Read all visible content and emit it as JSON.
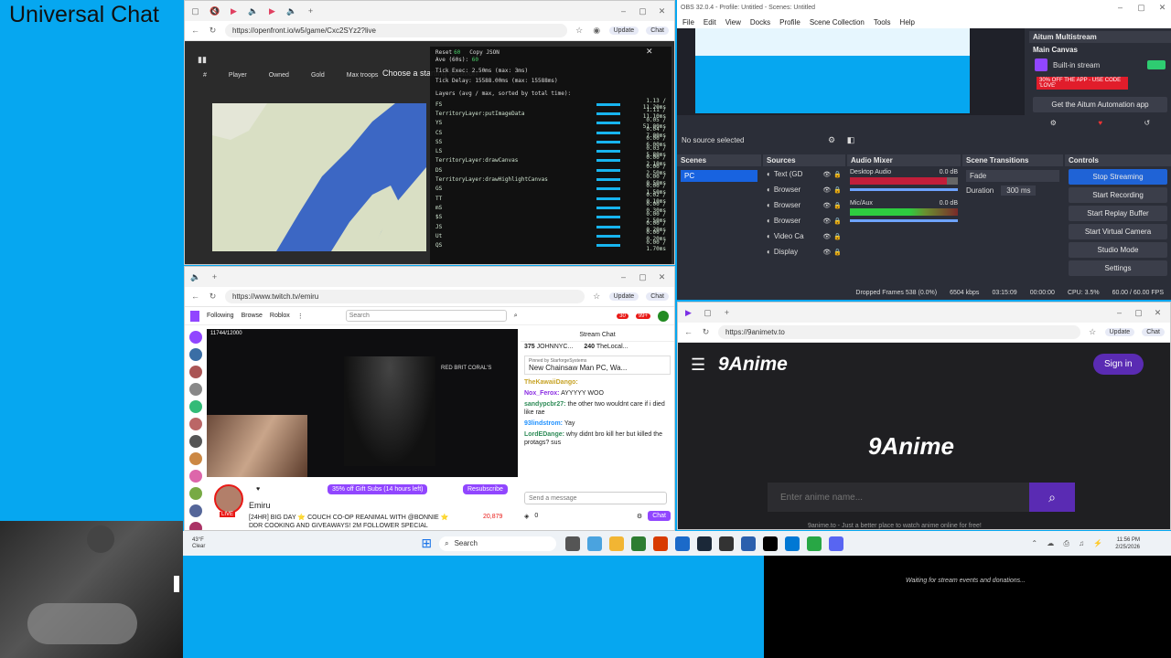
{
  "overlay_title": "Universal Chat",
  "stream_status": "Waiting for stream events and donations...",
  "openfront": {
    "url": "https://openfront.io/w5/game/Cxc2SYz2?live",
    "update_label": "Update",
    "chat_label": "Chat",
    "columns": [
      "#",
      "Player",
      "Owned",
      "Gold",
      "Max troops"
    ],
    "overlay_text": "Choose a starting location",
    "reset_label": "Reset",
    "reset_value": "60",
    "copy_label": "Copy JSON",
    "ave_label": "Ave (60s):",
    "ave_value": "60",
    "tick_exec": "Tick Exec: 2.50ms (max: 3ms)",
    "tick_delay": "Tick Delay: 15588.00ms (max: 15588ms)",
    "layers_header": "Layers (avg / max, sorted by total time):",
    "layers": [
      {
        "name": "FS",
        "value": "1.13 / 11.20ms"
      },
      {
        "name": "TerritoryLayer:putImageData",
        "value": "1.11 / 11.10ms"
      },
      {
        "name": "YS",
        "value": "0.05 / 51.00ms"
      },
      {
        "name": "CS",
        "value": "0.04 / 7.00ms"
      },
      {
        "name": "SS",
        "value": "0.00 / 6.00ms"
      },
      {
        "name": "LS",
        "value": "0.03 / 5.80ms"
      },
      {
        "name": "TerritoryLayer:drawCanvas",
        "value": "0.00 / 2.10ms"
      },
      {
        "name": "DS",
        "value": "0.00 / 2.50ms"
      },
      {
        "name": "TerritoryLayer:drawHighlightCanvas",
        "value": "0.00 / 0.50ms"
      },
      {
        "name": "GS",
        "value": "0.00 / 1.50ms"
      },
      {
        "name": "TT",
        "value": "0.02 / 0.10ms"
      },
      {
        "name": "mS",
        "value": "0.00 / 0.30ms"
      },
      {
        "name": "$S",
        "value": "0.00 / 2.50ms"
      },
      {
        "name": "JS",
        "value": "0.00 / 0.20ms"
      },
      {
        "name": "Ut",
        "value": "0.00 / 0.20ms"
      },
      {
        "name": "QS",
        "value": "0.00 / 1.70ms"
      }
    ]
  },
  "obs": {
    "window_title": "OBS 32.0.4 - Profile: Untitled - Scenes: Untitled",
    "menu": [
      "File",
      "Edit",
      "View",
      "Docks",
      "Profile",
      "Scene Collection",
      "Tools",
      "Help"
    ],
    "no_source": "No source selected",
    "scenes_header": "Scenes",
    "scene_items": [
      "PC"
    ],
    "sources_header": "Sources",
    "source_items": [
      "Text (GD",
      "Browser",
      "Browser",
      "Browser",
      "Video Ca",
      "Display"
    ],
    "mixer_header": "Audio Mixer",
    "mixer": [
      {
        "name": "Desktop Audio",
        "db": "0.0 dB"
      },
      {
        "name": "Mic/Aux",
        "db": "0.0 dB"
      }
    ],
    "transitions_header": "Scene Transitions",
    "transition_type": "Fade",
    "duration_label": "Duration",
    "duration_value": "300 ms",
    "controls_header": "Controls",
    "controls": [
      "Stop Streaming",
      "Start Recording",
      "Start Replay Buffer",
      "Start Virtual Camera",
      "Studio Mode",
      "Settings"
    ],
    "aitum_title": "Aitum Multistream",
    "main_canvas": "Main Canvas",
    "builtin_stream": "Built-in stream",
    "promo": "30% OFF THE APP - USE CODE 'LOVE'",
    "get_aitum": "Get the Aitum Automation app",
    "status": {
      "dropped": "Dropped Frames 538 (0.0%)",
      "kbps": "6504 kbps",
      "live_time": "03:15:09",
      "rec_time": "00:00:00",
      "cpu": "CPU: 3.5%",
      "fps": "60.00 / 60.00 FPS"
    }
  },
  "twitch": {
    "url": "https://www.twitch.tv/emiru",
    "update_label": "Update",
    "chat_label": "Chat",
    "nav": [
      "Following",
      "Browse",
      "Roblox"
    ],
    "search_placeholder": "Search",
    "notif_count": "30",
    "msg_count": "99+",
    "video_counter": "11744/12000",
    "video_overlay": "RED BRIT CORAL'S",
    "streamer": "Emiru",
    "live_label": "LIVE",
    "gift_subs": "35% off Gift Subs (14 hours left)",
    "resubscribe": "Resubscribe",
    "stream_title": "[24HR] BIG DAY ⭐ COUCH CO-OP REANIMAL WITH @BONNIE ⭐",
    "stream_subtitle": "DDR COOKING AND GIVEAWAYS! 2M FOLLOWER SPECIAL",
    "viewers": "20,879",
    "chat_header": "Stream Chat",
    "gifters": [
      {
        "count": "375",
        "name": "JOHNNYC..."
      },
      {
        "count": "240",
        "name": "TheLocal..."
      }
    ],
    "pinned_by": "Pinned by",
    "pinned_user": "StarforgeSystems",
    "pinned_text": "New Chainsaw Man PC, Wa...",
    "messages": [
      {
        "user": "TheKawaiiDango:",
        "text": "",
        "color": "#c7a326"
      },
      {
        "user": "Nox_Ferox:",
        "text": "AYYYYY WOO",
        "color": "#8a2be2"
      },
      {
        "user": "sandypcbr27:",
        "text": "the other two wouldnt care if i died like rae",
        "color": "#2e8b57"
      },
      {
        "user": "93lindstrom:",
        "text": "Yay",
        "color": "#1e90ff"
      },
      {
        "user": "LordEDange:",
        "text": "why didnt bro kill her but killed the protags? sus",
        "color": "#2e8b57"
      }
    ],
    "send_placeholder": "Send a message",
    "points": "0",
    "chat_button": "Chat"
  },
  "anime": {
    "url": "https://9animetv.to",
    "update_label": "Update",
    "chat_label": "Chat",
    "logo": "9Anime",
    "sign_in": "Sign in",
    "search_placeholder": "Enter anime name...",
    "tagline": "9anime.to - Just a better place to watch anime online for free!"
  },
  "taskbar": {
    "weather_temp": "43°F",
    "weather_desc": "Clear",
    "search": "Search",
    "time": "11:56 PM",
    "date": "2/25/2026"
  }
}
